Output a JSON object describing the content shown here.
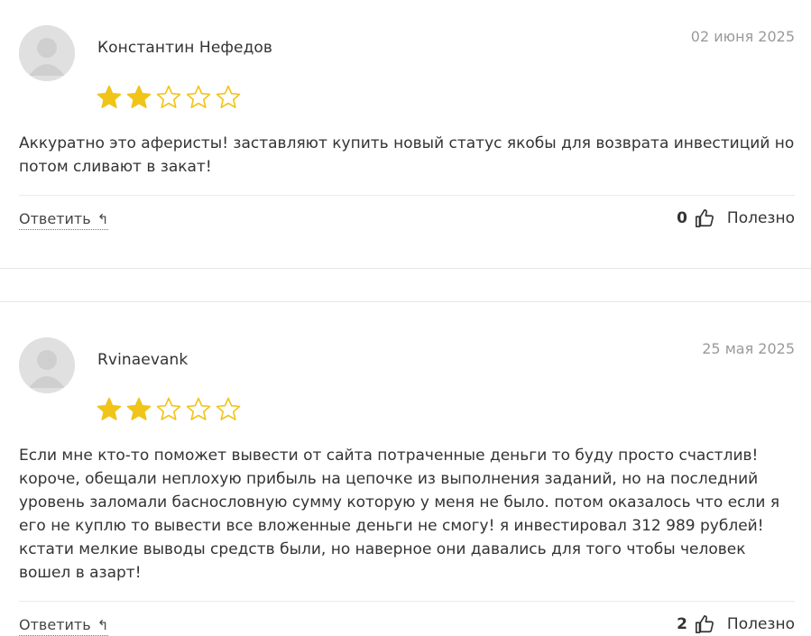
{
  "reviews": [
    {
      "author": "Константин Нефедов",
      "date": "02 июня 2025",
      "rating": 2,
      "max_rating": 5,
      "text": "Аккуратно это аферисты! заставляют купить новый статус якобы для возврата инвестиций но потом сливают в закат!",
      "reply_label": "Ответить",
      "reply_icon": "reply-arrow-icon",
      "helpful_count": "0",
      "helpful_label": "Полезно"
    },
    {
      "author": "Rvinaevank",
      "date": "25 мая 2025",
      "rating": 2,
      "max_rating": 5,
      "text": "Если мне кто-то поможет вывести от сайта потраченные деньги то буду просто счастлив! короче, обещали неплохую прибыль на цепочке из выполнения заданий, но на последний уровень заломали баснословную сумму которую у меня не было. потом оказалось что если я его не куплю то вывести все вложенные деньги не смогу! я инвестировал 312 989 рублей! кстати мелкие выводы средств были, но наверное они давались для того чтобы человек вошел в азарт!",
      "reply_label": "Ответить",
      "reply_icon": "reply-arrow-icon",
      "helpful_count": "2",
      "helpful_label": "Полезно"
    }
  ],
  "colors": {
    "star_filled": "#f0c419",
    "star_empty_stroke": "#f0c419",
    "date": "#9a9a9a"
  }
}
